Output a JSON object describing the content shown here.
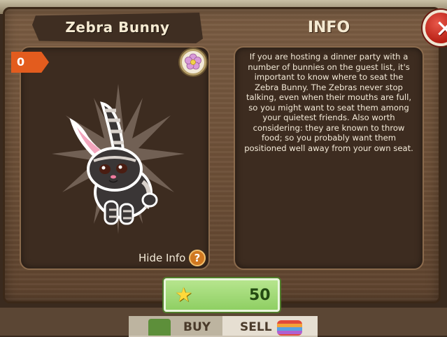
{
  "window": {
    "item_title": "Zebra Bunny",
    "info_heading": "INFO",
    "close_label": "✕"
  },
  "item": {
    "count": "0",
    "badge_icon": "flower-icon",
    "description": "If you are hosting a dinner party with a number of bunnies on the guest list, it's important to know where to seat the Zebra Bunny. The Zebras never stop talking, even when their mouths are full, so you might want to seat them among your quietest friends.  Also worth considering:  they are known to throw food; so you probably want them positioned well away from your own seat.",
    "hide_info_label": "Hide Info",
    "help_label": "?"
  },
  "price": {
    "star_icon": "★",
    "value": "50"
  },
  "tabs": {
    "buy_label": "BUY",
    "sell_label": "SELL"
  },
  "colors": {
    "panel": "#6b4e36",
    "close": "#c62a1d",
    "price_green": "#a3dc78",
    "tag_orange": "#e35c1e"
  }
}
